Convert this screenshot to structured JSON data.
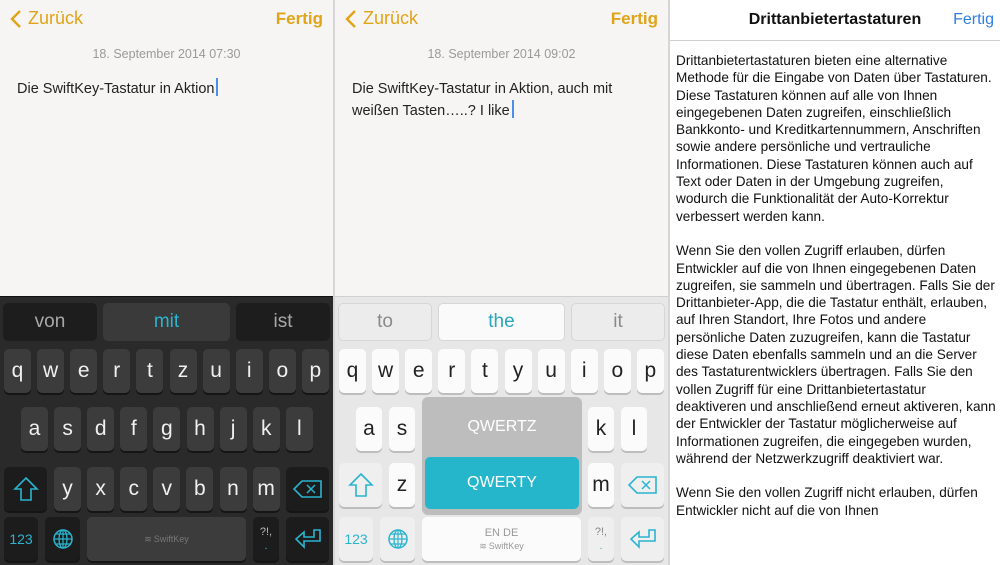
{
  "panels": [
    {
      "nav": {
        "back_label": "Zurück",
        "done_label": "Fertig"
      },
      "date": "18. September 2014 07:30",
      "note_text": "Die SwiftKey-Tastatur in Aktion",
      "keyboard": {
        "theme": "dark",
        "suggestions": [
          "von",
          "mit",
          "ist"
        ],
        "row1": [
          "q",
          "w",
          "e",
          "r",
          "t",
          "z",
          "u",
          "i",
          "o",
          "p"
        ],
        "row2": [
          "a",
          "s",
          "d",
          "f",
          "g",
          "h",
          "j",
          "k",
          "l"
        ],
        "row3": [
          "y",
          "x",
          "c",
          "v",
          "b",
          "n",
          "m"
        ],
        "numbers_label": "123",
        "punct_top": "?!,",
        "punct_bottom": ".",
        "space_brand": "SwiftKey"
      }
    },
    {
      "nav": {
        "back_label": "Zurück",
        "done_label": "Fertig"
      },
      "date": "18. September 2014 09:02",
      "note_text": "Die SwiftKey-Tastatur in Aktion, auch mit weißen Tasten…..? I like",
      "keyboard": {
        "theme": "light",
        "suggestions": [
          "to",
          "the",
          "it"
        ],
        "row1": [
          "q",
          "w",
          "e",
          "r",
          "t",
          "y",
          "u",
          "i",
          "o",
          "p"
        ],
        "row2": [
          "a",
          "s",
          "k",
          "l"
        ],
        "row3": [
          "z",
          "m"
        ],
        "numbers_label": "123",
        "punct_top": "?!,",
        "punct_bottom": ".",
        "space_languages": "EN DE",
        "space_brand": "SwiftKey",
        "layout_popup": {
          "options": [
            "QWERTZ",
            "QWERTY"
          ],
          "selected": "QWERTY"
        }
      }
    }
  ],
  "settings": {
    "title": "Drittanbietertastaturen",
    "done_label": "Fertig",
    "paragraphs": [
      "Drittanbietertastaturen bieten eine alternative Methode für die Eingabe von Daten über Tastaturen. Diese Tastaturen können auf alle von Ihnen eingegebenen Daten zugreifen, einschließlich Bankkonto- und Kreditkartennummern, Anschriften sowie andere persönliche und vertrauliche Informationen. Diese Tastaturen können auch auf Text oder Daten in der Umgebung zugreifen, wodurch die Funktionalität der Auto-Korrektur verbessert werden kann.",
      "Wenn Sie den vollen Zugriff erlauben, dürfen Entwickler auf die von Ihnen eingegebenen Daten zugreifen, sie sammeln und übertragen. Falls Sie der Drittanbieter-App, die die Tastatur enthält, erlauben, auf Ihren Standort, Ihre Fotos und andere persönliche Daten zuzugreifen, kann die Tastatur diese Daten ebenfalls sammeln und an die Server des Tastaturentwicklers übertragen. Falls Sie den vollen Zugriff für eine Drittanbietertastatur deaktiveren und anschließend erneut aktiveren, kann der Entwickler der Tastatur möglicherweise auf Informationen zugreifen, die eingegeben wurden, während der Netzwerkzugriff deaktiviert war.",
      "Wenn Sie den vollen Zugriff nicht erlauben, dürfen Entwickler nicht auf die von Ihnen"
    ]
  },
  "colors": {
    "accent_yellow": "#e0a418",
    "accent_cyan": "#2ab4d0",
    "ios_blue": "#2f7ee8",
    "popup_selected": "#26b6cc"
  }
}
